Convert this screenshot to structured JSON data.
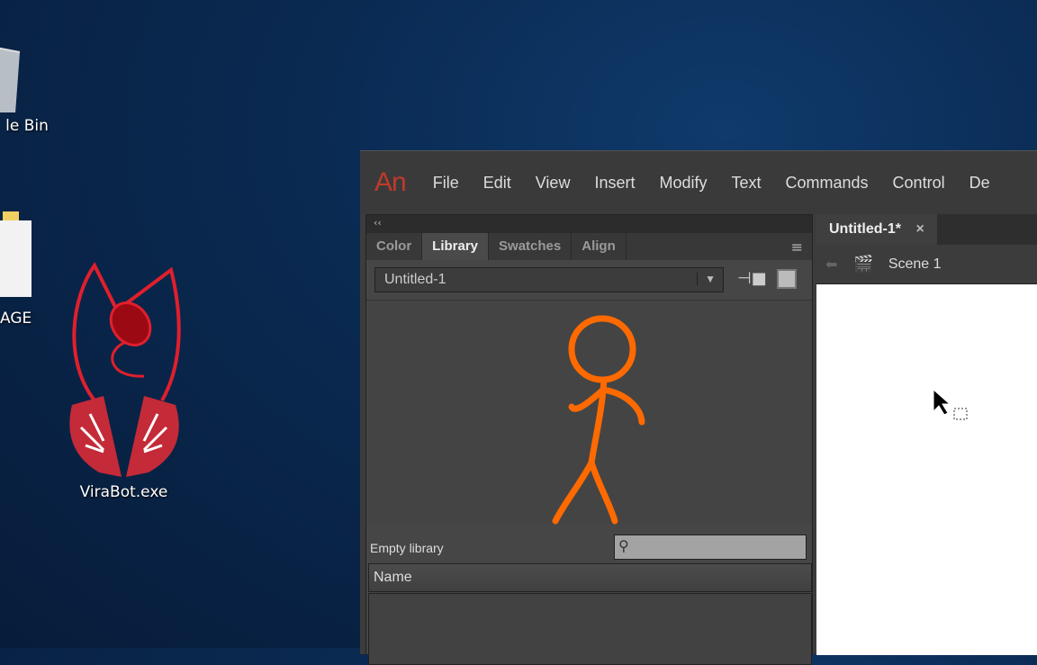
{
  "desktop": {
    "icons": [
      {
        "label": "le Bin",
        "icon": "recycle-bin-icon"
      },
      {
        "label": "AGE",
        "icon": "folder-icon"
      },
      {
        "label": "ViraBot.exe",
        "icon": "virabot-icon"
      }
    ]
  },
  "app": {
    "logo": "An",
    "menu": [
      "File",
      "Edit",
      "View",
      "Insert",
      "Modify",
      "Text",
      "Commands",
      "Control",
      "De"
    ]
  },
  "panel": {
    "collapse": "‹‹",
    "tabs": [
      "Color",
      "Library",
      "Swatches",
      "Align"
    ],
    "active_tab": "Library",
    "document_select": "Untitled-1",
    "status": "Empty library",
    "search_placeholder": "",
    "column_name": "Name"
  },
  "document": {
    "tab": "Untitled-1*",
    "close": "×",
    "scene": "Scene 1"
  },
  "colors": {
    "accent": "#ff6a00",
    "logo": "#c0392b"
  }
}
